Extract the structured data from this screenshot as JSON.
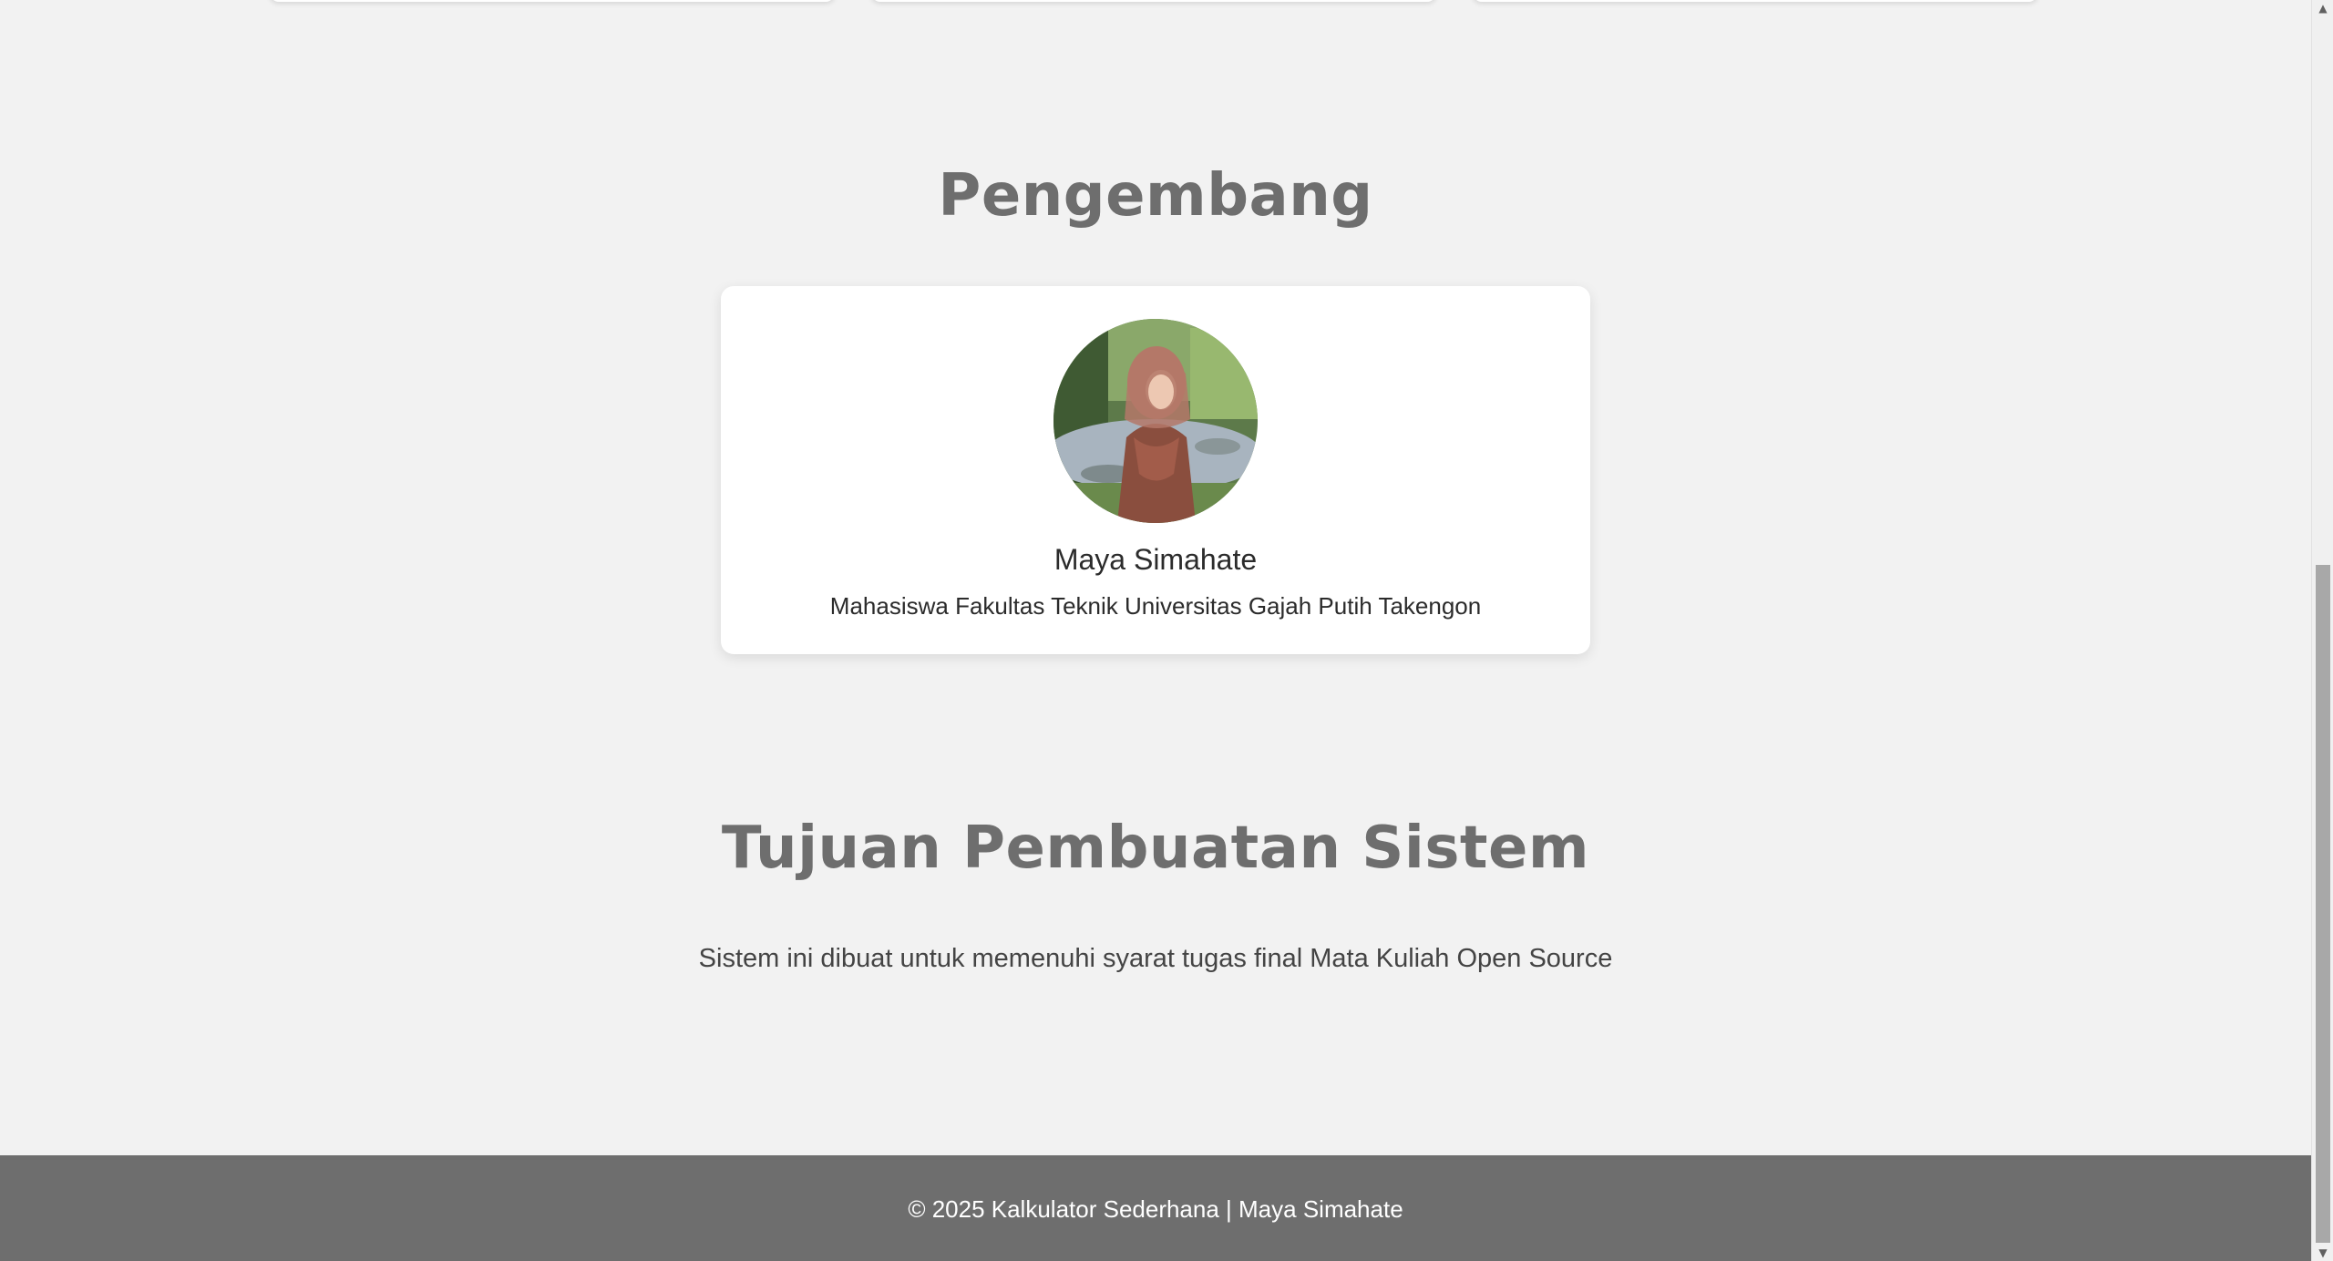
{
  "developer_section": {
    "title": "Pengembang",
    "name": "Maya Simahate",
    "role": "Mahasiswa Fakultas Teknik Universitas Gajah Putih Takengon"
  },
  "goal_section": {
    "title": "Tujuan Pembuatan Sistem",
    "text": "Sistem ini dibuat untuk memenuhi syarat tugas final Mata Kuliah Open Source"
  },
  "footer": {
    "text": "© 2025 Kalkulator Sederhana | Maya Simahate"
  },
  "scrollbar": {
    "up_icon": "▲",
    "down_icon": "▼"
  },
  "colors": {
    "background": "#f2f2f2",
    "heading": "#6e6e6e",
    "footer_bg": "#6e6e6e",
    "card_bg": "#ffffff"
  }
}
